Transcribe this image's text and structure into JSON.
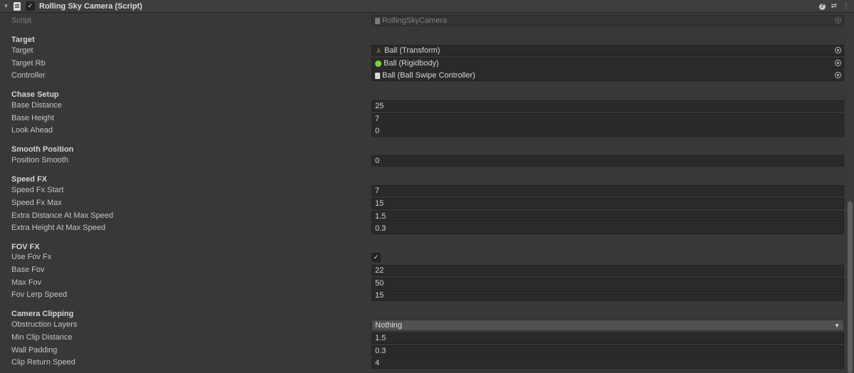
{
  "header": {
    "title": "Rolling Sky Camera (Script)",
    "enabled": true,
    "icons": [
      "help-icon",
      "presets-icon",
      "more-menu-icon"
    ]
  },
  "script": {
    "label": "Script",
    "value": "RollingSkyCamera"
  },
  "sections": {
    "target": {
      "title": "Target",
      "target": {
        "label": "Target",
        "value": "Ball (Transform)",
        "icon": "transform-icon"
      },
      "target_rb": {
        "label": "Target Rb",
        "value": "Ball (Rigidbody)",
        "icon": "rigidbody-icon"
      },
      "controller": {
        "label": "Controller",
        "value": "Ball (Ball Swipe Controller)",
        "icon": "script-icon"
      }
    },
    "chase": {
      "title": "Chase Setup",
      "base_distance": {
        "label": "Base Distance",
        "value": "25"
      },
      "base_height": {
        "label": "Base Height",
        "value": "7"
      },
      "look_ahead": {
        "label": "Look Ahead",
        "value": "0"
      }
    },
    "smooth": {
      "title": "Smooth Position",
      "position_smooth": {
        "label": "Position Smooth",
        "value": "0"
      }
    },
    "speed": {
      "title": "Speed FX",
      "fx_start": {
        "label": "Speed Fx Start",
        "value": "7"
      },
      "fx_max": {
        "label": "Speed Fx Max",
        "value": "15"
      },
      "extra_distance": {
        "label": "Extra Distance At Max Speed",
        "value": "1.5"
      },
      "extra_height": {
        "label": "Extra Height At Max Speed",
        "value": "0.3"
      }
    },
    "fov": {
      "title": "FOV FX",
      "use_fov": {
        "label": "Use Fov Fx",
        "checked": true
      },
      "base_fov": {
        "label": "Base Fov",
        "value": "22"
      },
      "max_fov": {
        "label": "Max Fov",
        "value": "50"
      },
      "fov_lerp": {
        "label": "Fov Lerp Speed",
        "value": "15"
      }
    },
    "clipping": {
      "title": "Camera Clipping",
      "obstruction": {
        "label": "Obstruction Layers",
        "value": "Nothing"
      },
      "min_clip": {
        "label": "Min Clip Distance",
        "value": "1.5"
      },
      "wall_padding": {
        "label": "Wall Padding",
        "value": "0.3"
      },
      "clip_return": {
        "label": "Clip Return Speed",
        "value": "4"
      }
    }
  },
  "glyphs": {
    "check": "✓",
    "fold": "▼",
    "dropdown_arrow": "▼",
    "help": "?",
    "presets": "⇄",
    "more": "⋮"
  },
  "colors": {
    "background": "#383838",
    "field": "#2a2a2a",
    "header": "#3e3e3e",
    "rigidbody_green": "#7cd13a",
    "transform_orange": "#e8a33a"
  }
}
